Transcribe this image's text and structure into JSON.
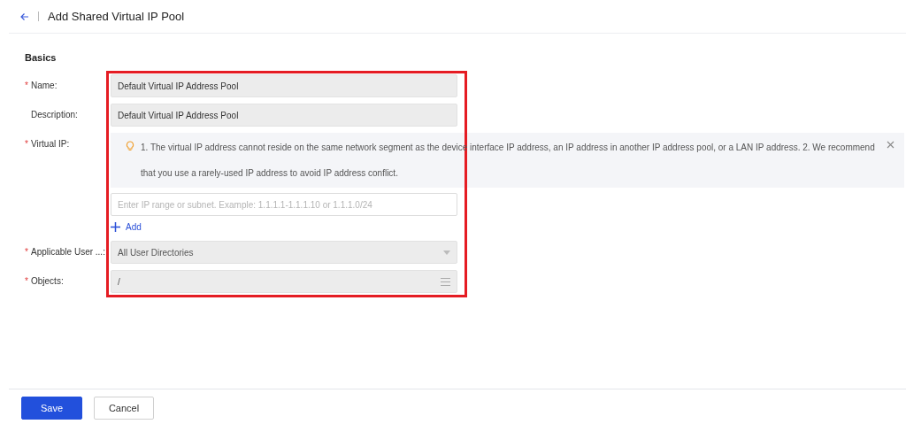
{
  "header": {
    "title": "Add Shared Virtual IP Pool"
  },
  "section": {
    "title": "Basics"
  },
  "fields": [
    {
      "kind": "text",
      "label": "Name:",
      "required_mark": "*",
      "disabled": true,
      "value": "Default Virtual IP Address Pool"
    },
    {
      "kind": "text",
      "label": "Description:",
      "disabled": true,
      "value": "Default Virtual IP Address Pool"
    },
    {
      "kind": "ip",
      "label": "Virtual IP:",
      "required_mark": "*",
      "notice": "1. The virtual IP address cannot reside on the same network segment as the device interface IP address, an IP address in another IP address pool, or a LAN IP address. 2. We recommend that you use a rarely-used IP address to avoid IP address conflict.",
      "placeholder": "Enter IP range or subnet. Example: 1.1.1.1-1.1.1.10 or 1.1.1.0/24",
      "add_label": "Add"
    },
    {
      "kind": "select",
      "label": "Applicable User ...:",
      "required_mark": "*",
      "disabled": true,
      "placeholder": "All User Directories"
    },
    {
      "kind": "list",
      "label": "Objects:",
      "required_mark": "*",
      "disabled": true,
      "value": "/"
    }
  ],
  "buttons": [
    {
      "label": "Save",
      "primary": true
    },
    {
      "label": "Cancel",
      "primary": false
    }
  ]
}
